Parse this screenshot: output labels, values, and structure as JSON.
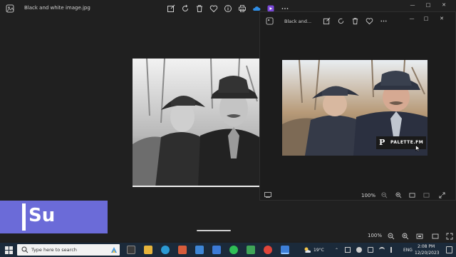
{
  "main_window": {
    "title": "Black and white image.jpg",
    "zoom": "100%"
  },
  "second_window": {
    "title": "Black and...",
    "zoom": "100%"
  },
  "color_photo": {
    "watermark_letter": "P",
    "watermark_text": "PALETTE.FM"
  },
  "overlay": {
    "text": "Su",
    "color": "#6b6bd8"
  },
  "taskbar": {
    "search_placeholder": "Type here to search",
    "weather": "19°C",
    "language": "ENG",
    "time": "2:08 PM",
    "date": "12/20/2023"
  },
  "colors": {
    "window_bg": "#202020",
    "taskbar_bg": "#1b2a3a"
  }
}
